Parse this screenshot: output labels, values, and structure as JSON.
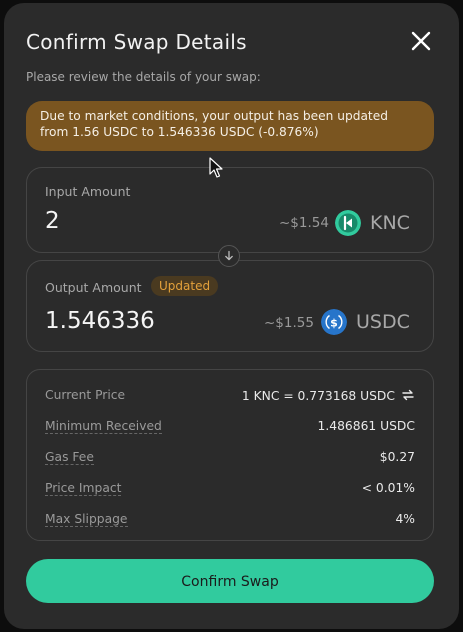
{
  "modal": {
    "title": "Confirm Swap Details",
    "subtitle": "Please review the details of your swap:",
    "warning": "Due to market conditions, your output has been updated from 1.56 USDC to 1.546336 USDC (-0.876%)"
  },
  "input": {
    "label": "Input Amount",
    "amount": "2",
    "usd": "~$1.54",
    "token": "KNC",
    "token_icon": "knc-icon",
    "token_color": "#31cb9e"
  },
  "output": {
    "label": "Output Amount",
    "badge": "Updated",
    "amount": "1.546336",
    "usd": "~$1.55",
    "token": "USDC",
    "token_icon": "usdc-icon",
    "token_color": "#2775ca"
  },
  "details": [
    {
      "key": "Current Price",
      "value": "1 KNC = 0.773168 USDC"
    },
    {
      "key": "Minimum Received",
      "value": "1.486861 USDC"
    },
    {
      "key": "Gas Fee",
      "value": "$0.27"
    },
    {
      "key": "Price Impact",
      "value": "< 0.01%"
    },
    {
      "key": "Max Slippage",
      "value": "4%"
    }
  ],
  "confirm_label": "Confirm Swap",
  "colors": {
    "accent": "#31cb9e",
    "warning_bg": "#7a5520",
    "badge_text": "#e3a13b"
  }
}
